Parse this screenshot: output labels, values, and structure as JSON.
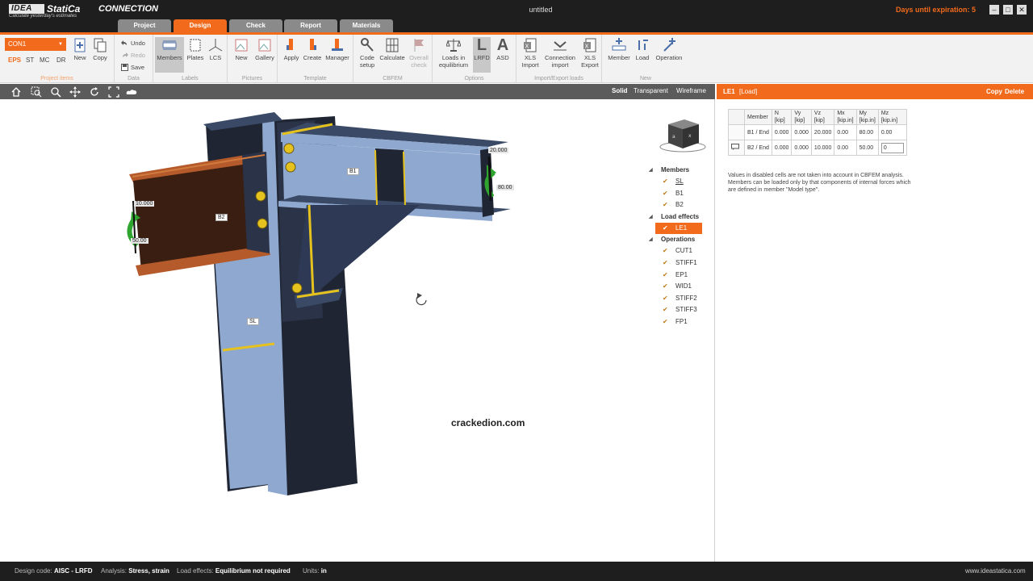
{
  "app": {
    "brand": "IDEA",
    "brand_name": "StatiCa",
    "tagline": "Calculate yesterday's estimates",
    "product": "CONNECTION",
    "window_title": "untitled",
    "expiry": "Days until expiration: 5"
  },
  "tabs": [
    "Project",
    "Design",
    "Check",
    "Report",
    "Materials"
  ],
  "active_tab": "Design",
  "ribbon": {
    "project_items": {
      "title": "Project items",
      "connection": "CON1",
      "codes": [
        "EPS",
        "ST",
        "MC",
        "DR"
      ],
      "active_code": "EPS",
      "new": "New",
      "copy": "Copy"
    },
    "data": {
      "title": "Data",
      "undo": "Undo",
      "redo": "Redo",
      "save": "Save"
    },
    "labels": {
      "title": "Labels",
      "members": "Members",
      "plates": "Plates",
      "lcs": "LCS"
    },
    "pictures": {
      "title": "Pictures",
      "new": "New",
      "gallery": "Gallery"
    },
    "template": {
      "title": "Template",
      "apply": "Apply",
      "create": "Create",
      "manager": "Manager"
    },
    "cbfem": {
      "title": "CBFEM",
      "code_setup": "Code setup",
      "calculate": "Calculate",
      "overall_check": "Overall check"
    },
    "options": {
      "title": "Options",
      "loads_eq": "Loads in equilibrium",
      "lrfd": "LRFD",
      "asd": "ASD",
      "lrfd_glyph": "L",
      "asd_glyph": "A"
    },
    "import_export": {
      "title": "Import/Export loads",
      "xls_import": "XLS Import",
      "conn_import": "Connection import",
      "xls_export": "XLS Export"
    },
    "new_group": {
      "title": "New",
      "member": "Member",
      "load": "Load",
      "operation": "Operation"
    }
  },
  "view": {
    "modes": [
      "Solid",
      "Transparent",
      "Wireframe"
    ],
    "active_mode": "Solid"
  },
  "scene": {
    "member_labels": {
      "b1": "B1",
      "b2": "B2",
      "sl": "SL"
    },
    "values": {
      "b1_vz": "20.000",
      "b1_my": "80.00",
      "b2_vz": "10.000",
      "b2_my": "50.00"
    },
    "watermark": "crackedion.com",
    "viewcube_faces": {
      "left": "a",
      "right": "x"
    }
  },
  "tree": {
    "members_title": "Members",
    "members": [
      "SL",
      "B1",
      "B2"
    ],
    "load_effects_title": "Load effects",
    "load_effects": [
      "LE1"
    ],
    "operations_title": "Operations",
    "operations": [
      "CUT1",
      "STIFF1",
      "EP1",
      "WID1",
      "STIFF2",
      "STIFF3",
      "FP1"
    ]
  },
  "panel": {
    "title": "LE1",
    "subtitle": "[Load]",
    "copy": "Copy",
    "delete": "Delete",
    "headers": [
      {
        "name": "Member",
        "unit": ""
      },
      {
        "name": "N",
        "unit": "[kip]"
      },
      {
        "name": "Vy",
        "unit": "[kip]"
      },
      {
        "name": "Vz",
        "unit": "[kip]"
      },
      {
        "name": "Mx",
        "unit": "[kip.in]"
      },
      {
        "name": "My",
        "unit": "[kip.in]"
      },
      {
        "name": "Mz",
        "unit": "[kip.in]"
      }
    ],
    "rows": [
      [
        "B1 / End",
        "0.000",
        "0.000",
        "20.000",
        "0.00",
        "80.00",
        "0.00"
      ],
      [
        "B2 / End",
        "0.000",
        "0.000",
        "10.000",
        "0.00",
        "50.00",
        "0"
      ]
    ],
    "note": "Values in disabled cells are not taken into account in CBFEM analysis. Members can be loaded only by that components of internal forces which are defined in member \"Model type\"."
  },
  "status": {
    "design_code_label": "Design code:",
    "design_code": "AISC - LRFD",
    "analysis_label": "Analysis:",
    "analysis": "Stress, strain",
    "load_effects_label": "Load effects:",
    "load_effects": "Equilibrium not required",
    "units_label": "Units:",
    "units": "in",
    "url": "www.ideastatica.com"
  },
  "colors": {
    "accent": "#f26a1b",
    "dark_bar": "#1e1e1e",
    "steel_blue": "#8fa8cf",
    "steel_dark": "#1f2533",
    "weld_yellow": "#e6c21e",
    "load_green": "#2fa52f",
    "tree_check": "#c27b18"
  }
}
